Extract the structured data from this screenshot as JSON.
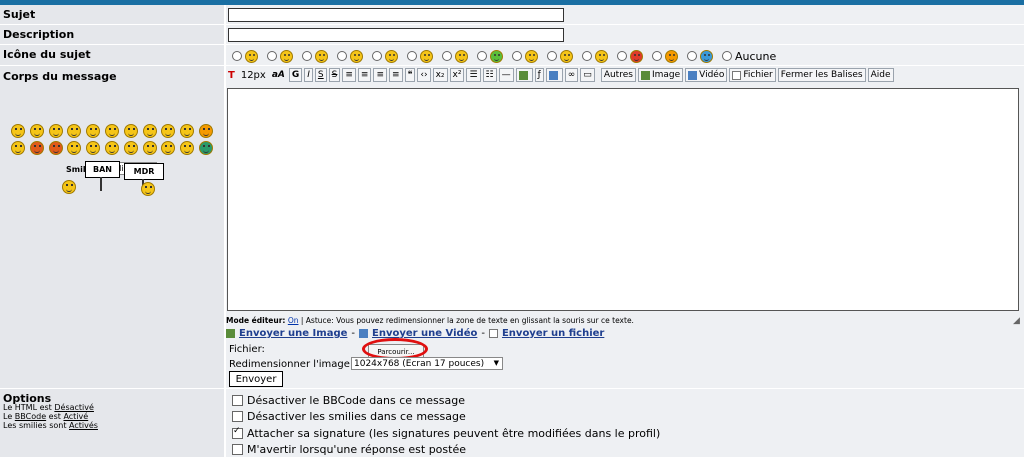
{
  "labels": {
    "sujet": "Sujet",
    "description": "Description",
    "icone": "Icône du sujet",
    "corps": "Corps du message"
  },
  "icons_row": {
    "smiley_colors": [
      "#f5c518",
      "#f5c518",
      "#f5c518",
      "#f5c518",
      "#f5c518",
      "#f5c518",
      "#f5c518",
      "#5bbf3a",
      "#f5c518",
      "#f5c518",
      "#f5c518",
      "#e03a2a",
      "#f59a00",
      "#3a9ad9"
    ],
    "aucune": "Aucune"
  },
  "toolbar": {
    "font_size": "12px",
    "font_style": "aA",
    "bold": "G",
    "italic": "I",
    "underline": "S",
    "strike": "S",
    "autres": "Autres",
    "image": "Image",
    "video": "Vidéo",
    "fichier": "Fichier",
    "fermer": "Fermer les Balises",
    "aide": "Aide"
  },
  "smilies": {
    "label": "Smilies:",
    "selected": "Smilies1",
    "row1_colors": [
      "#f5c518",
      "#f5c518",
      "#f5c518",
      "#f5c518",
      "#f5c518",
      "#f5c518",
      "#f5c518",
      "#f5c518",
      "#f5c518",
      "#f5c518",
      "#f59a00"
    ],
    "row2_colors": [
      "#f5c518",
      "#e05a1a",
      "#e05a1a",
      "#f5c518",
      "#f5c518",
      "#f5c518",
      "#f5c518",
      "#f5c518",
      "#f5c518",
      "#f5c518",
      "#2a9a6a"
    ],
    "sign_ban": "BAN",
    "sign_mdr": "MDR"
  },
  "mode": {
    "label": "Mode éditeur:",
    "state": "On",
    "tip": "| Astuce: Vous pouvez redimensionner la zone de texte en glissant la souris sur ce texte."
  },
  "upload": {
    "image": "Envoyer une Image",
    "video": "Envoyer une Vidéo",
    "fichier": "Envoyer un fichier",
    "sep": "-",
    "fichier_label": "Fichier:",
    "parcourir": "Parcourir...",
    "redim_label": "Redimensionner l'image ?",
    "redim_value": "1024x768 (Ecran 17 pouces)",
    "envoyer": "Envoyer"
  },
  "options": {
    "title": "Options",
    "html_prefix": "Le HTML est",
    "html_state": "Désactivé",
    "bbcode_prefix": "Le",
    "bbcode_link": "BBCode",
    "bbcode_mid": "est",
    "bbcode_state": "Activé",
    "smilies_prefix": "Les smilies sont",
    "smilies_state": "Activés",
    "checks": [
      {
        "label": "Désactiver le BBCode dans ce message",
        "checked": false
      },
      {
        "label": "Désactiver les smilies dans ce message",
        "checked": false
      },
      {
        "label": "Attacher sa signature (les signatures peuvent être modifiées dans le profil)",
        "checked": true
      },
      {
        "label": "M'avertir lorsqu'une réponse est postée",
        "checked": false
      }
    ]
  }
}
